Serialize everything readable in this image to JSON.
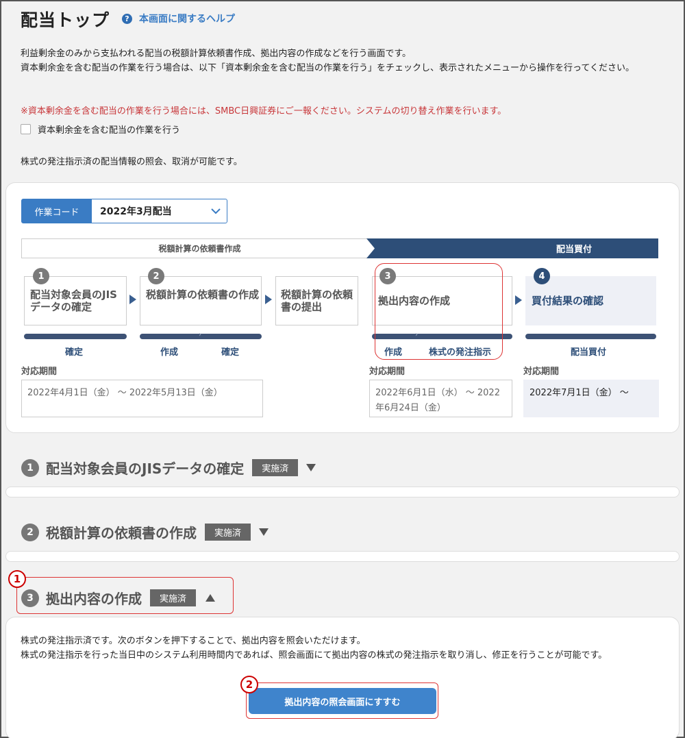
{
  "header": {
    "title": "配当トップ",
    "help_icon": "question-circle-icon",
    "help_label": "本画面に関するヘルプ"
  },
  "intro": {
    "line1": "利益剰余金のみから支払われる配当の税額計算依頼書作成、拠出内容の作成などを行う画面です。",
    "line2": "資本剰余金を含む配当の作業を行う場合は、以下「資本剰余金を含む配当の作業を行う」をチェックし、表示されたメニューから操作を行ってください。",
    "warning": "※資本剰余金を含む配当の作業を行う場合には、SMBC日興証券にご一報ください。システムの切り替え作業を行います。",
    "checkbox_label": "資本剰余金を含む配当の作業を行う",
    "info": "株式の発注指示済の配当情報の照会、取消が可能です。"
  },
  "work_code": {
    "label": "作業コード",
    "value": "2022年3月配当"
  },
  "phases": {
    "left": "税額計算の依頼書作成",
    "right": "配当買付"
  },
  "steps": [
    {
      "num": "1",
      "title": "配当対象会員のJISデータの確定"
    },
    {
      "num": "2",
      "title": "税額計算の依頼書の作成"
    },
    {
      "num": "",
      "title": "税額計算の依頼書の提出"
    },
    {
      "num": "3",
      "title": "拠出内容の作成"
    },
    {
      "num": "4",
      "title": "買付結果の確認"
    }
  ],
  "progress_labels": {
    "s1": "確定",
    "s2a": "作成",
    "s2b": "確定",
    "s3a": "作成",
    "s3b": "株式の発注指示",
    "s4": "配当買付"
  },
  "periods": {
    "label": "対応期間",
    "p1": "2022年4月1日（金） 〜 2022年5月13日（金）",
    "p3": "2022年6月1日（水） 〜 2022年6月24日（金）",
    "p4": "2022年7月1日（金） 〜"
  },
  "sections": [
    {
      "num": "1",
      "title": "配当対象会員のJISデータの確定",
      "status": "実施済"
    },
    {
      "num": "2",
      "title": "税額計算の依頼書の作成",
      "status": "実施済"
    },
    {
      "num": "3",
      "title": "拠出内容の作成",
      "status": "実施済"
    }
  ],
  "callouts": {
    "c1": "1",
    "c2": "2"
  },
  "section3_body": {
    "line1": "株式の発注指示済です。次のボタンを押下することで、拠出内容を照会いただけます。",
    "line2": "株式の発注指示を行った当日中のシステム利用時間内であれば、照会画面にて拠出内容の株式の発注指示を取り消し、修正を行うことが可能です。",
    "button": "拠出内容の照会画面にすすむ"
  },
  "colors": {
    "accent": "#3a7cc4",
    "navy": "#2d4e78",
    "warning": "#c8373a",
    "callout": "#cc0000"
  }
}
